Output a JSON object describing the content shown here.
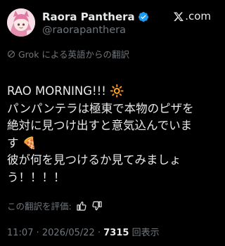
{
  "header": {
    "display_name": "Raora Panthera",
    "handle": "@raorapanthera",
    "brand_label": ".com"
  },
  "translation": {
    "label": "Grok による英語からの翻訳"
  },
  "tweet": {
    "line1": "RAO MORNING!!! 🔆",
    "line2": "パンパンテラは極東で本物のピザを",
    "line3": "絶対に見つけ出すと意気込んでいま",
    "line4": "す 🍕",
    "line5": "彼が何を見つけるか見てみましょ",
    "line6": "う！！！！"
  },
  "rate": {
    "label": "この翻訳を評価:"
  },
  "meta": {
    "time": "11:07",
    "separator": "·",
    "date": "2026/05/22",
    "views_count": "7315",
    "views_label": "回表示"
  },
  "colors": {
    "background": "#000000",
    "text": "#e7e9ea",
    "muted": "#71767b",
    "verified": "#1d9bf0"
  }
}
